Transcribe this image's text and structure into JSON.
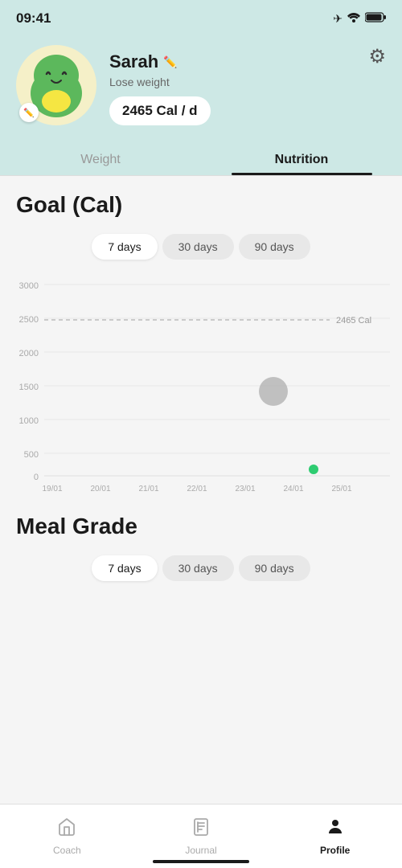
{
  "statusBar": {
    "time": "09:41"
  },
  "header": {
    "userName": "Sarah",
    "editIcon": "✏️",
    "goal": "Lose weight",
    "calories": "2465 Cal / d",
    "settingsIcon": "⚙"
  },
  "tabs": [
    {
      "label": "Weight",
      "active": false
    },
    {
      "label": "Nutrition",
      "active": true
    }
  ],
  "goalSection": {
    "title": "Goal (Cal)",
    "periods": [
      {
        "label": "7 days",
        "active": true
      },
      {
        "label": "30 days",
        "active": false
      },
      {
        "label": "90 days",
        "active": false
      }
    ],
    "chart": {
      "yMax": 3000,
      "yLabels": [
        "3000",
        "2500",
        "2000",
        "1500",
        "1000",
        "500",
        "0"
      ],
      "xLabels": [
        "19/01",
        "20/01",
        "21/01",
        "22/01",
        "23/01",
        "24/01",
        "25/01"
      ],
      "goalLine": 2465,
      "goalLabel": "2465 Cal"
    }
  },
  "mealGradeSection": {
    "title": "Meal Grade",
    "periods": [
      {
        "label": "7 days",
        "active": true
      },
      {
        "label": "30 days",
        "active": false
      },
      {
        "label": "90 days",
        "active": false
      }
    ]
  },
  "bottomNav": [
    {
      "label": "Coach",
      "icon": "house",
      "active": false
    },
    {
      "label": "Journal",
      "icon": "journal",
      "active": false
    },
    {
      "label": "Profile",
      "icon": "person",
      "active": true
    }
  ]
}
